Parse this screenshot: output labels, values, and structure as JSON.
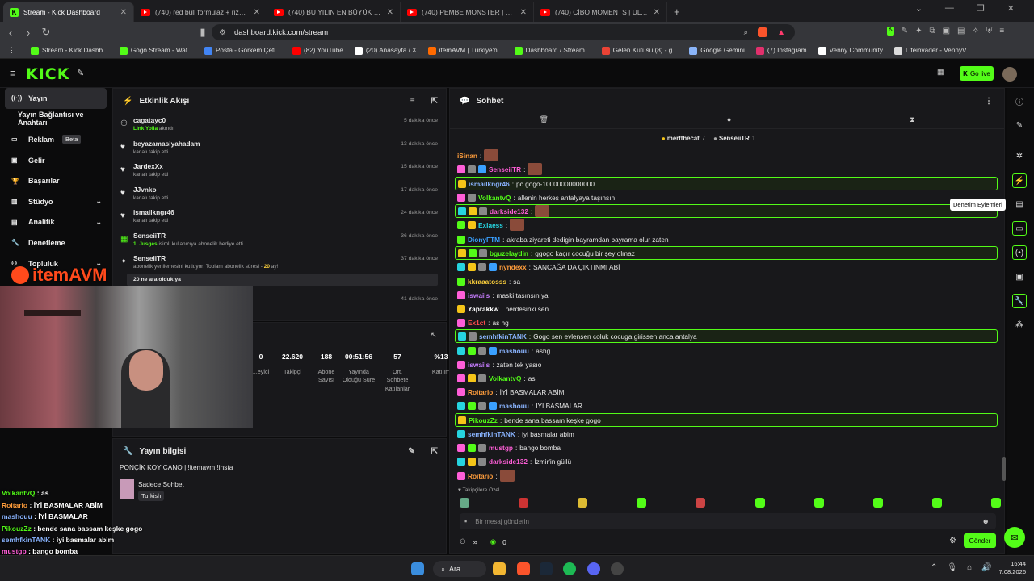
{
  "browser": {
    "tabs": [
      {
        "title": "Stream - Kick Dashboard",
        "type": "kick"
      },
      {
        "title": "(740) red bull formulaz + rize vlog -",
        "type": "yt"
      },
      {
        "title": "(740) BU YILIN EN BÜYÜK DRAMASI",
        "type": "yt"
      },
      {
        "title": "(740) PEMBE MONSTER | Madara Oi",
        "type": "yt"
      },
      {
        "title": "(740) CİBO MOMENTS | ULTRA HIZLI",
        "type": "yt"
      }
    ],
    "url": "dashboard.kick.com/stream",
    "bookmarks": [
      {
        "label": "Stream - Kick Dashb...",
        "color": "#53fc18"
      },
      {
        "label": "Gogo Stream - Wat...",
        "color": "#53fc18"
      },
      {
        "label": "Posta - Görkem Çeti...",
        "color": "#4285f4"
      },
      {
        "label": "(82) YouTube",
        "color": "#ff0000"
      },
      {
        "label": "(20) Anasayfa / X",
        "color": "#ffffff"
      },
      {
        "label": "itemAVM | Türkiye'n...",
        "color": "#ff6a00"
      },
      {
        "label": "Dashboard / Stream...",
        "color": "#53fc18"
      },
      {
        "label": "Gelen Kutusu (8) - g...",
        "color": "#ea4335"
      },
      {
        "label": "Google Gemini",
        "color": "#8ab4f8"
      },
      {
        "label": "(7) Instagram",
        "color": "#e1306c"
      },
      {
        "label": "Venny Community",
        "color": "#ffffff"
      },
      {
        "label": "Lifeinvader - VennyV",
        "color": "#dddddd"
      }
    ]
  },
  "kick": {
    "logo": "KICK",
    "go_live": "Go live"
  },
  "sidebar": [
    {
      "label": "Yayın",
      "icon": "broadcast-icon",
      "active": true
    },
    {
      "label": "Yayın Bağlantısı ve Anahtarı",
      "icon": "",
      "indent": true
    },
    {
      "label": "Reklam",
      "icon": "ad-icon",
      "badge": "Beta"
    },
    {
      "label": "Gelir",
      "icon": "wallet-icon"
    },
    {
      "label": "Başarılar",
      "icon": "trophy-icon"
    },
    {
      "label": "Stüdyo",
      "icon": "studio-icon",
      "chevron": true
    },
    {
      "label": "Analitik",
      "icon": "chart-icon",
      "chevron": true
    },
    {
      "label": "Denetleme",
      "icon": "wrench-icon"
    },
    {
      "label": "Topluluk",
      "icon": "community-icon",
      "chevron": true
    }
  ],
  "activity": {
    "title": "Etkinlik Akışı",
    "events": [
      {
        "name": "cagatayc0",
        "desc_link": "Link Yolla",
        "desc": " akındı",
        "time": "5 dakika önce",
        "icon": "raid-icon"
      },
      {
        "name": "beyazamasiyahadam",
        "desc": "kanalı takip etti",
        "time": "13 dakika önce",
        "icon": "heart-icon"
      },
      {
        "name": "JardexXx",
        "desc": "kanalı takip etti",
        "time": "15 dakika önce",
        "icon": "heart-icon"
      },
      {
        "name": "JJvnko",
        "desc": "kanalı takip etti",
        "time": "17 dakika önce",
        "icon": "heart-icon"
      },
      {
        "name": "ismailkngr46",
        "desc": "kanalı takip etti",
        "time": "24 dakika önce",
        "icon": "heart-icon"
      },
      {
        "name": "SenseiiTR",
        "desc_link": "1, Jusges",
        "desc": " isimli kullanıcıya abonelik hediye etti.",
        "time": "36 dakika önce",
        "icon": "gift-icon"
      },
      {
        "name": "SenseiiTR",
        "desc": "abonelik yenilemesini kutluyor! Toplam abonelik süresi - ",
        "desc_hl": "20",
        "desc_end": " ay!",
        "time": "37 dakika önce",
        "icon": "star-icon",
        "note": "20 ne ara olduk ya"
      }
    ],
    "last_time": "41 dakika önce"
  },
  "stats": [
    {
      "value": "0",
      "label": "...eyici"
    },
    {
      "value": "22.620",
      "label": "Takipçi"
    },
    {
      "value": "188",
      "label": "Abone Sayısı"
    },
    {
      "value": "00:51:56",
      "label": "Yayında Olduğu Süre"
    },
    {
      "value": "57",
      "label": "Ort. Sohbete Katılanlar"
    },
    {
      "value": "%13",
      "label": "Katılım"
    }
  ],
  "stream_info": {
    "title": "Yayın bilgisi",
    "stream_title": "PONÇİK KOY CANO | !itemavm !insta",
    "category": "Sadece Sohbet",
    "tag": "Turkish"
  },
  "chat": {
    "title": "Sohbet",
    "tooltip": "Denetim Eylemleri",
    "top_gifters": [
      {
        "name": "mertthecat",
        "count": "7"
      },
      {
        "name": "SenseiiTR",
        "count": "1"
      }
    ],
    "messages": [
      {
        "user": "iSinan",
        "color": "#ff9d3c",
        "text": "",
        "emote": true
      },
      {
        "user": "SenseiiTR",
        "color": "#ff5ed8",
        "text": "",
        "emote": true,
        "badges": [
          "#ff5ed8",
          "#888",
          "#3aa0ff"
        ]
      },
      {
        "user": "ismailkngr46",
        "color": "#8ab4ff",
        "text": "pc gogo-10000000000000",
        "hl": true,
        "badges": [
          "#f5c518"
        ]
      },
      {
        "user": "VolkantvQ",
        "color": "#53fc18",
        "text": "allenin herkes antalyaya taşınsın",
        "badges": [
          "#ff5ed8",
          "#888"
        ]
      },
      {
        "user": "darkside132",
        "color": "#ff5ed8",
        "text": "",
        "emote": true,
        "hl": true,
        "badges": [
          "#26d4e0",
          "#f5c518",
          "#888"
        ]
      },
      {
        "user": "Exlaess",
        "color": "#26d4e0",
        "text": "",
        "emote": true,
        "badges": [
          "#53fc18",
          "#f5c518"
        ]
      },
      {
        "user": "DionyFTM",
        "color": "#3aa0ff",
        "text": "akraba ziyareti dedigin bayramdan bayrama olur zaten",
        "badges": [
          "#53fc18"
        ]
      },
      {
        "user": "bguzelaydin",
        "color": "#53fc18",
        "text": "ggogo kaçır çocuğu bir şey olmaz",
        "hl": true,
        "badges": [
          "#f5c518",
          "#53fc18",
          "#888"
        ]
      },
      {
        "user": "nyndexx",
        "color": "#ff9d3c",
        "text": "SANCAĞA DA ÇIKTINMI ABİ",
        "badges": [
          "#26d4e0",
          "#f5c518",
          "#888",
          "#3aa0ff"
        ]
      },
      {
        "user": "kkraaatosss",
        "color": "#ffd23c",
        "text": "sa",
        "badges": [
          "#53fc18"
        ]
      },
      {
        "user": "iswails",
        "color": "#c77dff",
        "text": "maski tasınsın ya",
        "badges": [
          "#ff5ed8"
        ]
      },
      {
        "user": "Yaprakkw",
        "color": "#ffffff",
        "text": "nerdesinki sen",
        "badges": [
          "#f5c518"
        ]
      },
      {
        "user": "Ex1ct",
        "color": "#ff4d4d",
        "text": "as hg",
        "badges": [
          "#ff5ed8"
        ]
      },
      {
        "user": "semhfkinTANK",
        "color": "#8ab4ff",
        "text": "Gogo sen evlensen coluk cocuga girissen anca antalya",
        "hl": true,
        "badges": [
          "#26d4e0",
          "#888"
        ]
      },
      {
        "user": "mashouu",
        "color": "#8ab4ff",
        "text": "ashg",
        "badges": [
          "#26d4e0",
          "#53fc18",
          "#888",
          "#3aa0ff"
        ]
      },
      {
        "user": "iswails",
        "color": "#c77dff",
        "text": "zaten tek yasıo",
        "badges": [
          "#ff5ed8"
        ]
      },
      {
        "user": "VolkantvQ",
        "color": "#53fc18",
        "text": "as",
        "badges": [
          "#ff5ed8",
          "#f5c518",
          "#888"
        ]
      },
      {
        "user": "Roitario",
        "color": "#ff9d3c",
        "text": "İYİ BASMALAR ABİM",
        "badges": [
          "#ff5ed8"
        ]
      },
      {
        "user": "mashouu",
        "color": "#8ab4ff",
        "text": "İYİ BASMALAR",
        "badges": [
          "#26d4e0",
          "#53fc18",
          "#888",
          "#3aa0ff"
        ]
      },
      {
        "user": "PikouzZz",
        "color": "#53fc18",
        "text": "bende sana bassam keşke gogo",
        "hl": true,
        "badges": [
          "#f5c518"
        ]
      },
      {
        "user": "semhfkinTANK",
        "color": "#8ab4ff",
        "text": "iyi basmalar abim",
        "badges": [
          "#26d4e0"
        ]
      },
      {
        "user": "mustgp",
        "color": "#ff5ed8",
        "text": "bango bomba",
        "badges": [
          "#ff5ed8",
          "#53fc18",
          "#888"
        ]
      },
      {
        "user": "darkside132",
        "color": "#ff5ed8",
        "text": "İzmir'in güllü",
        "badges": [
          "#26d4e0",
          "#f5c518",
          "#888"
        ]
      },
      {
        "user": "Roitario",
        "color": "#ff9d3c",
        "text": "",
        "emote": true,
        "badges": [
          "#ff5ed8"
        ]
      }
    ],
    "emote_section": "Takipçilere Özel",
    "input_placeholder": "Bir mesaj gönderin",
    "send": "Gönder",
    "points": "0",
    "infinity": "∞"
  },
  "overlay": {
    "brand": "itemAVM",
    "lines": [
      {
        "user": "VolkantvQ",
        "color": "#53fc18",
        "text": "as"
      },
      {
        "user": "Roitario",
        "color": "#ff9d3c",
        "text": "İYİ BASMALAR ABİM"
      },
      {
        "user": "mashouu",
        "color": "#8ab4ff",
        "text": "İYİ BASMALAR"
      },
      {
        "user": "PikouzZz",
        "color": "#53fc18",
        "text": "bende sana bassam keşke gogo"
      },
      {
        "user": "semhfkinTANK",
        "color": "#8ab4ff",
        "text": "iyi basmalar abim"
      },
      {
        "user": "mustgp",
        "color": "#ff5ed8",
        "text": "bango bomba"
      },
      {
        "user": "darkside132",
        "color": "#ff5ed8",
        "text": "İzmir'in güllü"
      },
      {
        "user": "Roitario",
        "color": "#ff9d3c",
        "text": ""
      }
    ]
  },
  "taskbar": {
    "search": "Ara",
    "time": "16:44",
    "date": "7.08.2026"
  }
}
